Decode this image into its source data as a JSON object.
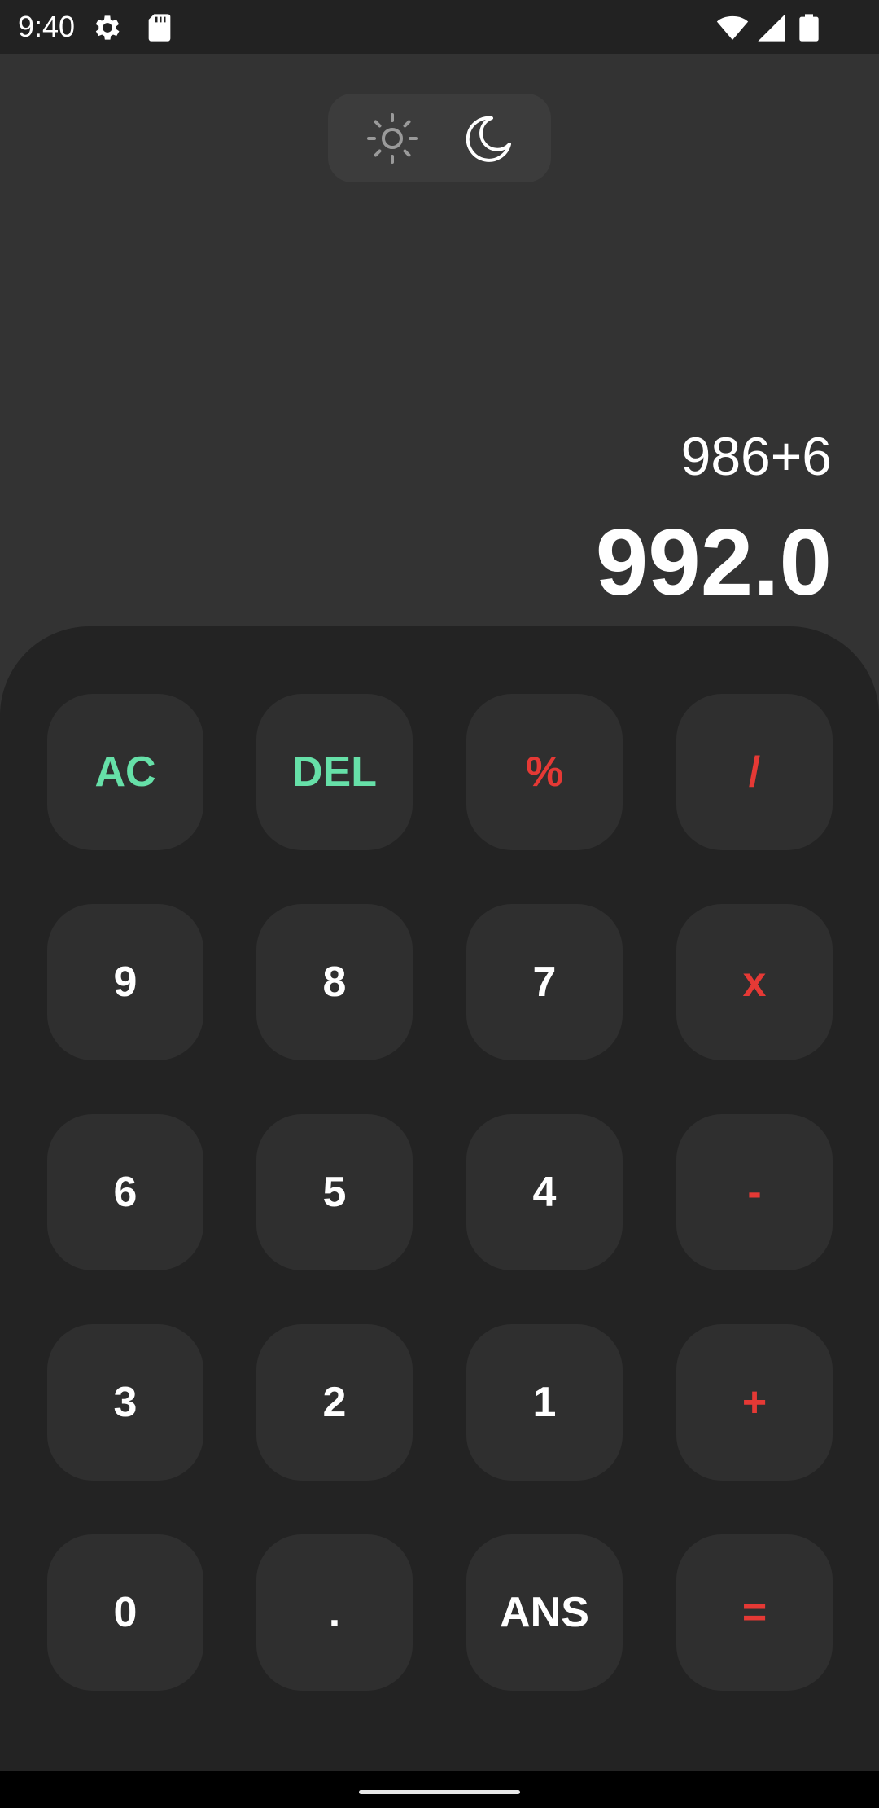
{
  "status_bar": {
    "time": "9:40",
    "left_icons": [
      "gear-icon",
      "sd-card-icon"
    ],
    "right_icons": [
      "wifi-icon",
      "signal-icon",
      "battery-icon"
    ]
  },
  "theme_toggle": {
    "options": [
      "sun-icon",
      "moon-icon"
    ],
    "selected": "moon-icon"
  },
  "display": {
    "expression": "986+6",
    "result": "992.0"
  },
  "keypad": {
    "rows": [
      [
        "AC",
        "DEL",
        "%",
        "/"
      ],
      [
        "9",
        "8",
        "7",
        "x"
      ],
      [
        "6",
        "5",
        "4",
        "-"
      ],
      [
        "3",
        "2",
        "1",
        "+"
      ],
      [
        "0",
        ".",
        "ANS",
        "="
      ]
    ]
  },
  "colors": {
    "background": "#333333",
    "keypad_background": "#232323",
    "key_background": "#2f2f2f",
    "accent_green": "#66e0a8",
    "accent_red": "#e53935",
    "text": "#ffffff"
  }
}
